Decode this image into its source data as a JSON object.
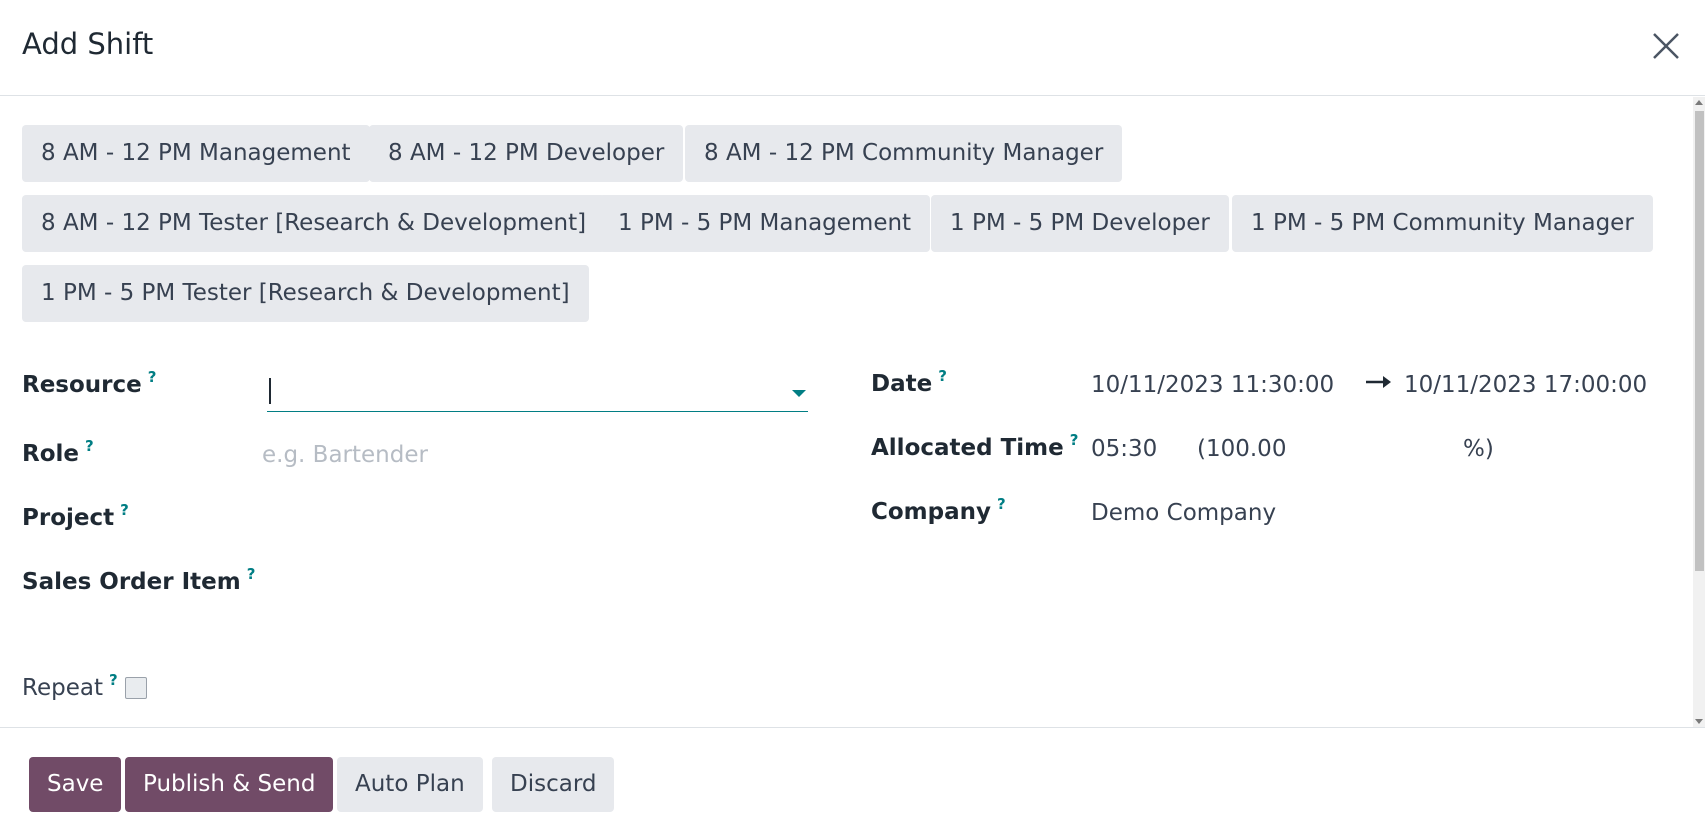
{
  "dialog": {
    "title": "Add Shift"
  },
  "templates": [
    "8 AM - 12 PM Management",
    "8 AM - 12 PM Developer",
    "8 AM - 12 PM Community Manager",
    "8 AM - 12 PM Tester [Research & Development]",
    "1 PM - 5 PM Management",
    "1 PM - 5 PM Developer",
    "1 PM - 5 PM Community Manager",
    "1 PM - 5 PM Tester [Research & Development]"
  ],
  "form": {
    "help_marker": "?",
    "resource": {
      "label": "Resource",
      "value": ""
    },
    "role": {
      "label": "Role",
      "placeholder": "e.g. Bartender"
    },
    "project": {
      "label": "Project"
    },
    "sales_order_item": {
      "label": "Sales Order Item"
    },
    "repeat": {
      "label": "Repeat",
      "checked": false
    },
    "date": {
      "label": "Date",
      "start": "10/11/2023 11:30:00",
      "end": "10/11/2023 17:00:00"
    },
    "allocated_time": {
      "label": "Allocated Time",
      "hours": "05:30",
      "percent_open": "(100.00",
      "percent_close": "%)"
    },
    "company": {
      "label": "Company",
      "value": "Demo Company"
    }
  },
  "footer": {
    "save": "Save",
    "publish_send": "Publish & Send",
    "auto_plan": "Auto Plan",
    "discard": "Discard"
  },
  "colors": {
    "primary": "#714b67",
    "accent": "#017e84",
    "secondary_bg": "#e7e9ed"
  }
}
